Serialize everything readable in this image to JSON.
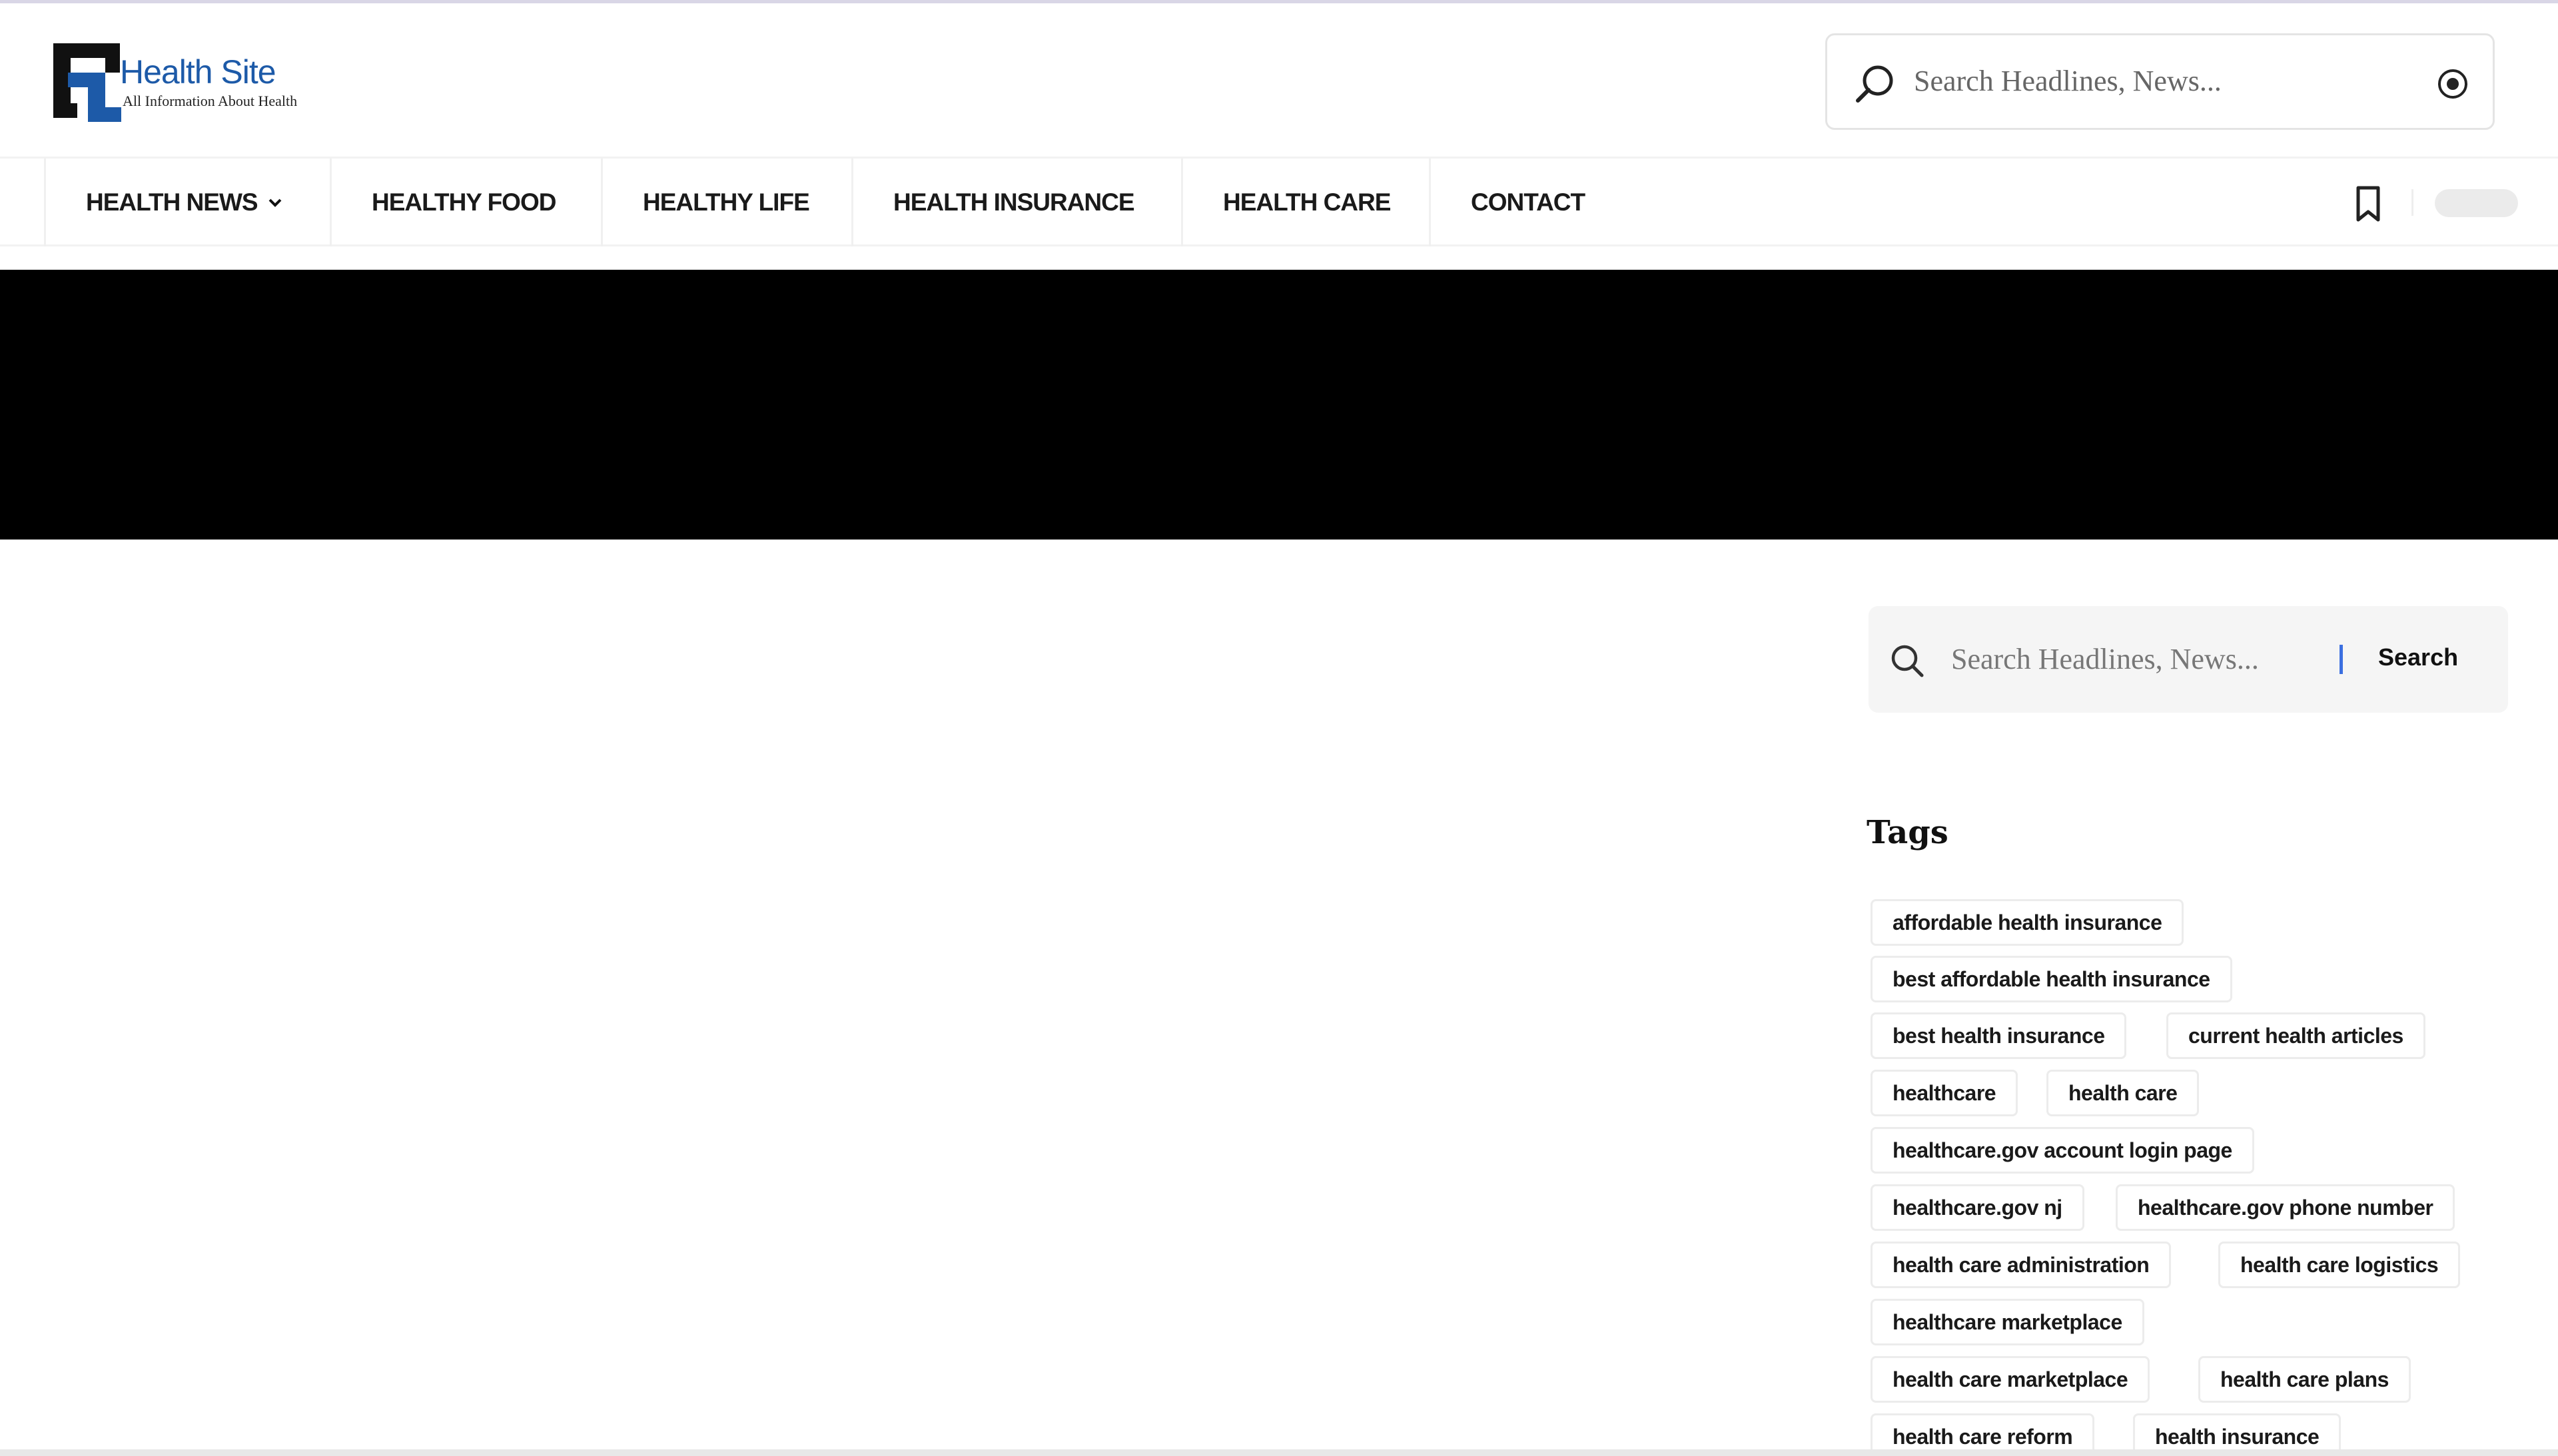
{
  "header": {
    "logo_title": "Health Site",
    "logo_subtitle": "All Information About Health",
    "search_placeholder": "Search Headlines, News...",
    "search_icon": "search-icon",
    "location_icon": "target-icon"
  },
  "nav": {
    "items": [
      {
        "label": "HEALTH NEWS",
        "has_dropdown": true
      },
      {
        "label": "HEALTHY FOOD"
      },
      {
        "label": "HEALTHY LIFE"
      },
      {
        "label": "HEALTH INSURANCE"
      },
      {
        "label": "HEALTH CARE"
      },
      {
        "label": "CONTACT"
      }
    ],
    "bookmark_icon": "bookmark-icon",
    "toggle": "theme-toggle"
  },
  "sidebar": {
    "search": {
      "placeholder": "Search Headlines, News...",
      "button_label": "Search",
      "accent_color": "#3b6fe0"
    },
    "tags_title": "Tags",
    "tags": [
      "affordable health insurance",
      "best affordable health insurance",
      "best health insurance",
      "current health articles",
      "healthcare",
      "health care",
      "healthcare.gov account login page",
      "healthcare.gov nj",
      "healthcare.gov phone number",
      "health care administration",
      "health care logistics",
      "healthcare marketplace",
      "health care marketplace",
      "health care plans",
      "health care reform",
      "health insurance"
    ]
  },
  "colors": {
    "brand_blue": "#1d5aa8",
    "banner": "#000000"
  }
}
